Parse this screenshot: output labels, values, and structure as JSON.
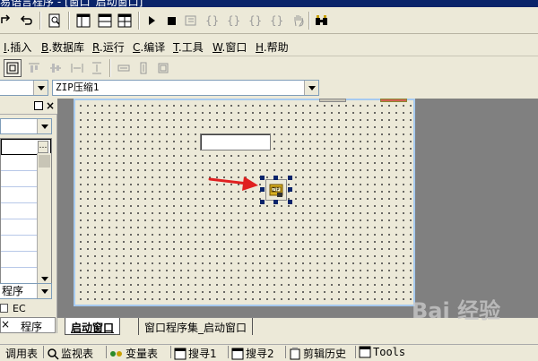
{
  "window": {
    "title_fragment": "易语言程序 - [窗口_启动窗口]"
  },
  "menu": [
    {
      "key": "I",
      "label": ".插入"
    },
    {
      "key": "B",
      "label": ".数据库"
    },
    {
      "key": "R",
      "label": ".运行"
    },
    {
      "key": "C",
      "label": ".编译"
    },
    {
      "key": "T",
      "label": ".工具"
    },
    {
      "key": "W",
      "label": ".窗口"
    },
    {
      "key": "H",
      "label": ".帮助"
    }
  ],
  "combos": {
    "left_value": "",
    "component_value": "ZIP压缩1"
  },
  "left_panel": {
    "dropdown_value": "",
    "type_select_value": "程序",
    "ec_label": "EC",
    "program_tab_label": "程序"
  },
  "tabs": [
    {
      "label": "启动窗口",
      "active": true
    },
    {
      "label": "窗口程序集_启动窗口",
      "active": false
    }
  ],
  "bottom_bar": [
    {
      "label": "调用表",
      "icon": "table-icon"
    },
    {
      "label": "监视表",
      "icon": "magnifier-icon"
    },
    {
      "label": "变量表",
      "icon": "variables-icon"
    },
    {
      "label": "搜寻1",
      "icon": "search-window-icon"
    },
    {
      "label": "搜寻2",
      "icon": "search-window-icon"
    },
    {
      "label": "剪辑历史",
      "icon": "clipboard-icon"
    },
    {
      "label": "Tools",
      "icon": "tools-icon"
    }
  ],
  "watermark": "Bai 经验",
  "colors": {
    "title_bar": "#0a246a",
    "form_border": "#a6caf0",
    "workspace": "#808080",
    "arrow": "#e02020",
    "selection_handle": "#0a246a"
  }
}
